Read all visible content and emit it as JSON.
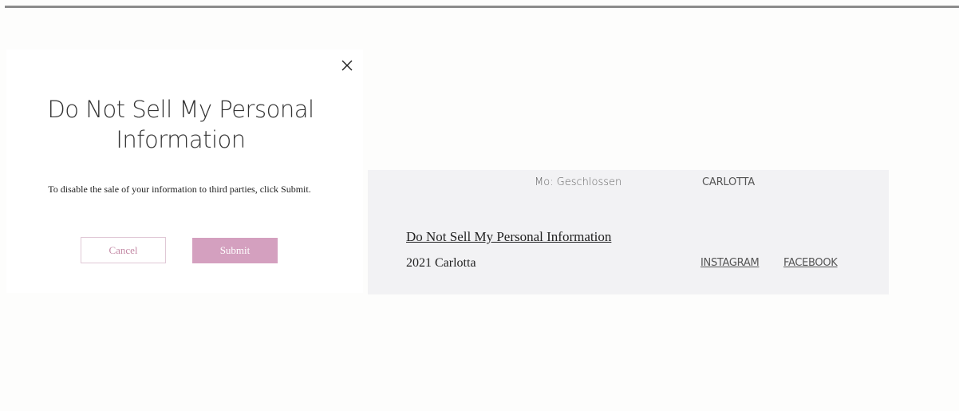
{
  "modal": {
    "title": "Do Not Sell My Personal Information",
    "description": "To disable the sale of your information to third parties, click Submit.",
    "cancel_label": "Cancel",
    "submit_label": "Submit"
  },
  "footer": {
    "hours": "Mo: Geschlossen",
    "brand": "CARLOTTA",
    "dnsmpi_link": "Do Not Sell My Personal Information",
    "copyright": "2021 Carlotta",
    "instagram": "INSTAGRAM",
    "facebook": "FACEBOOK"
  },
  "icons": {
    "close": "close-icon"
  },
  "colors": {
    "submit_bg": "#d4a0bf",
    "cancel_text": "#c48aa6",
    "footer_bg": "#f2f2f4",
    "page_bg": "#fdfdfc"
  }
}
